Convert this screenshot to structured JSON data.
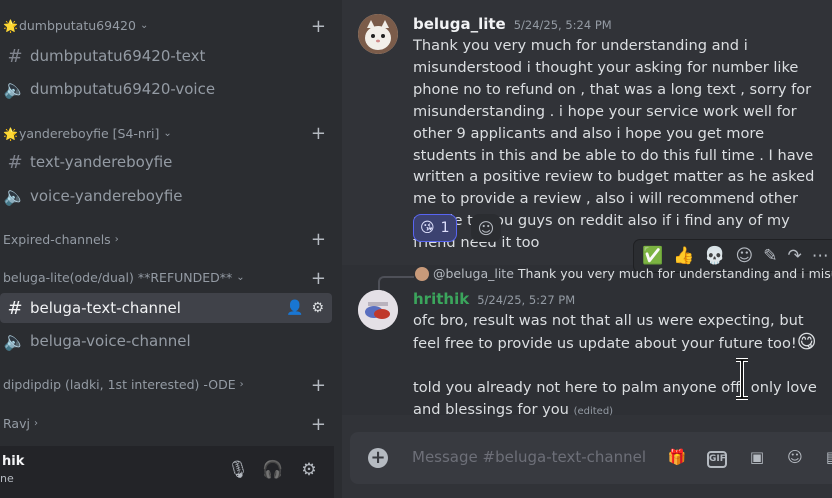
{
  "sidebar": {
    "categories": [
      {
        "emoji": "🌟",
        "name": "dumbputatu69420"
      },
      {
        "emoji": "🌟",
        "name": "yandereboyfie [S4-nri]"
      },
      {
        "emoji": "",
        "name": "Expired-channels"
      },
      {
        "emoji": "",
        "name": "beluga-lite(ode/dual) **REFUNDED**"
      },
      {
        "emoji": "",
        "name": "dipdipdip (ladki, 1st interested) -ODE"
      },
      {
        "emoji": "",
        "name": "Ravj"
      }
    ],
    "channels": [
      {
        "type": "text",
        "name": "dumbputatu69420-text"
      },
      {
        "type": "voice",
        "name": "dumbputatu69420-voice"
      },
      {
        "type": "text",
        "name": "text-yandereboyfie"
      },
      {
        "type": "voice",
        "name": "voice-yandereboyfie"
      },
      {
        "type": "text",
        "name": "beluga-text-channel"
      },
      {
        "type": "voice",
        "name": "beluga-voice-channel"
      }
    ]
  },
  "user_panel": {
    "name": "hik",
    "status": "ne"
  },
  "messages": [
    {
      "author": "beluga_lite",
      "author_color": "#f2f3f5",
      "timestamp": "5/24/25, 5:24 PM",
      "text": "Thank you very much for understanding and i misunderstood i thought your asking for number like phone no to refund on , that was a long text , sorry for misunderstanding . i hope your service work well for other 9 applicants and also i hope you get more students in this and be able to do this full time . I have written a positive review to budget matter as he asked me to provide a review , also i will recommend other people to you guys on reddit also if i find any of my friend need it too",
      "reaction": {
        "emoji": "😘",
        "count": "1"
      }
    },
    {
      "author": "hrithik",
      "author_color": "#3ba55c",
      "timestamp": "5/24/25, 5:27 PM",
      "reply_to": {
        "author": "@beluga_lite",
        "text": "Thank you very much for understanding and i misund..."
      },
      "line1": "ofc bro, result was not that all us were expecting, but feel free to provide us update about your future too!",
      "line1_emoji": "😋",
      "line2": "told you already not here to palm anyone off!  only love and blessings for you",
      "edited": "(edited)"
    }
  ],
  "hover_actions": [
    "✅",
    "👍",
    "💀"
  ],
  "composer": {
    "placeholder": "Message #beluga-text-channel"
  },
  "icons": {
    "gif_label": "GIF"
  }
}
